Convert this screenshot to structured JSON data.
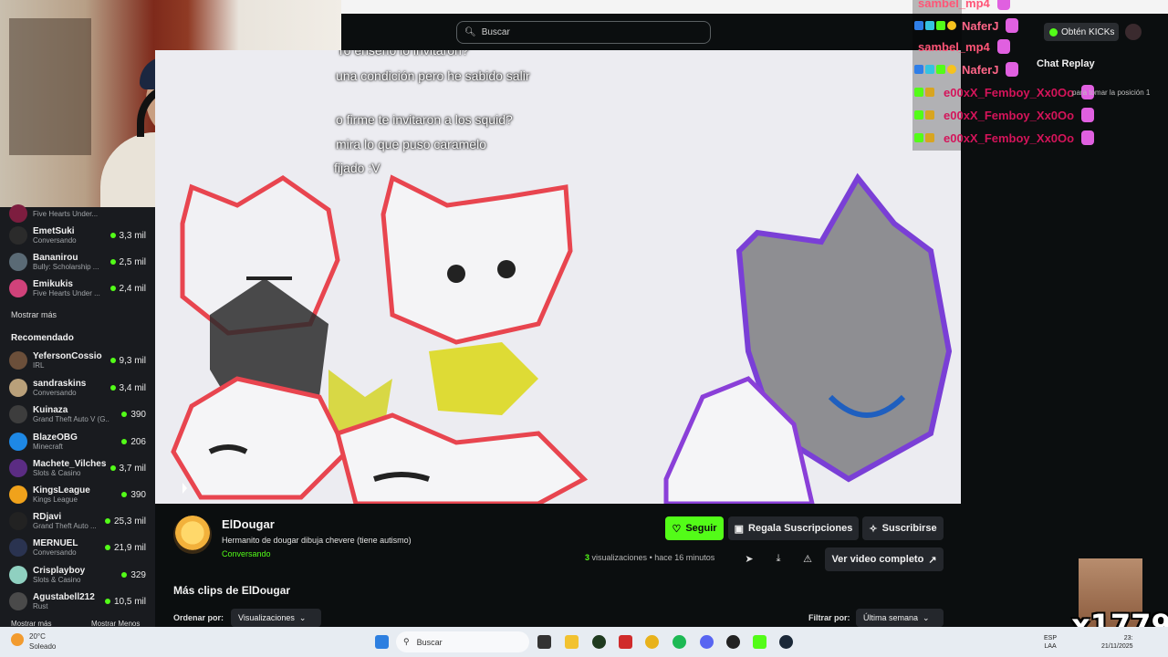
{
  "search": {
    "placeholder": "Buscar"
  },
  "sidebar": {
    "following": [
      {
        "name": "",
        "category": "Five Hearts Under...",
        "viewers": "",
        "avatar_color": "#7d1d3f"
      },
      {
        "name": "EmetSuki",
        "category": "Conversando",
        "viewers": "3,3 mil",
        "avatar_color": "#2b2b2b"
      },
      {
        "name": "Bananirou",
        "category": "Bully: Scholarship ...",
        "viewers": "2,5 mil",
        "avatar_color": "#5a6a75"
      },
      {
        "name": "Emikukis",
        "category": "Five Hearts Under ...",
        "viewers": "2,4 mil",
        "avatar_color": "#d0427a"
      }
    ],
    "show_more": "Mostrar más",
    "recommended_heading": "Recomendado",
    "recommended": [
      {
        "name": "YefersonCossio",
        "category": "IRL",
        "viewers": "9,3 mil",
        "avatar_color": "#6b4f3a"
      },
      {
        "name": "sandraskins",
        "category": "Conversando",
        "viewers": "3,4 mil",
        "avatar_color": "#b9a07a"
      },
      {
        "name": "Kuinaza",
        "category": "Grand Theft Auto V (G...",
        "viewers": "390",
        "avatar_color": "#3d3d3d"
      },
      {
        "name": "BlazeOBG",
        "category": "Minecraft",
        "viewers": "206",
        "avatar_color": "#1e88e5"
      },
      {
        "name": "Machete_Vilches",
        "category": "Slots & Casino",
        "viewers": "3,7 mil",
        "avatar_color": "#5b2c83"
      },
      {
        "name": "KingsLeague",
        "category": "Kings League",
        "viewers": "390",
        "avatar_color": "#f0a21b"
      },
      {
        "name": "RDjavi",
        "category": "Grand Theft Auto ...",
        "viewers": "25,3 mil",
        "avatar_color": "#222222"
      },
      {
        "name": "MERNUEL",
        "category": "Conversando",
        "viewers": "21,9 mil",
        "avatar_color": "#2a3350"
      },
      {
        "name": "Crisplayboy",
        "category": "Slots & Casino",
        "viewers": "329",
        "avatar_color": "#8fd0c0"
      },
      {
        "name": "Agustabell212",
        "category": "Rust",
        "viewers": "10,5 mil",
        "avatar_color": "#4a4a4a"
      }
    ],
    "bottom_left": "Mostrar más",
    "bottom_right": "Mostrar Menos"
  },
  "video_overlay": [
    "ro enserio lo invitaron?",
    "una condición pero he sabido salir",
    "o firme te invitaron a los squid?",
    "mira lo que puso caramelo",
    "fijado :V"
  ],
  "chat": {
    "lines": [
      {
        "user": "sambel_mp4",
        "color": "#ff5577"
      },
      {
        "user": "NaferJ",
        "color": "#ff6688"
      },
      {
        "user": "sambel_mp4",
        "color": "#ff5577"
      },
      {
        "user": "NaferJ",
        "color": "#ff6688"
      },
      {
        "user": "e00xX_Femboy_Xx0Oo",
        "color": "#d4145a"
      },
      {
        "user": "e00xX_Femboy_Xx0Oo",
        "color": "#d4145a"
      },
      {
        "user": "e00xX_Femboy_Xx0Oo",
        "color": "#d4145a"
      }
    ],
    "kicks_button": "Obtén KICKs",
    "replay_label": "Chat Replay",
    "position_note": "para tomar la posición 1"
  },
  "clip": {
    "streamer": "ElDougar",
    "title": "Hermanito de dougar dibuja chevere (tiene autismo)",
    "status": "Conversando",
    "follow": "Seguir",
    "gift": "Regala Suscripciones",
    "subscribe": "Suscribirse",
    "views_count": "3",
    "views_label": "visualizaciones",
    "time": "hace 16 minutos",
    "full_video": "Ver video completo"
  },
  "more_clips": {
    "heading": "Más clips de ElDougar",
    "sort_label": "Ordenar por:",
    "sort_value": "Visualizaciones",
    "filter_label": "Filtrar por:",
    "filter_value": "Última semana"
  },
  "taskbar": {
    "temp": "20°C",
    "weather": "Soleado",
    "search": "Buscar",
    "lang": "ESP",
    "region": "LAA",
    "time": "23:",
    "date": "21/11/2025"
  },
  "stamp": "x1779"
}
